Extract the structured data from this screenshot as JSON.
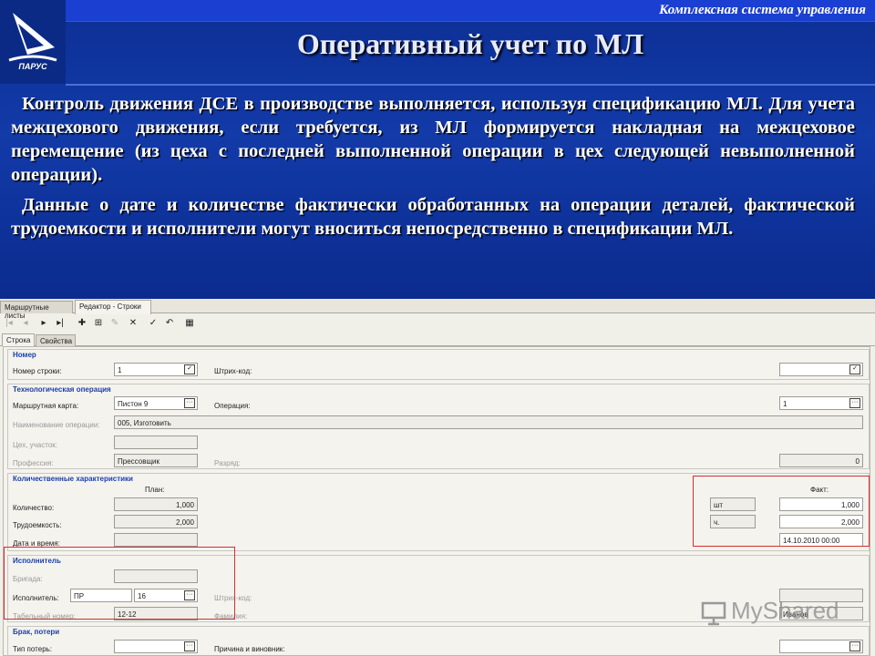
{
  "slide": {
    "header_text": "Комплексная система управления",
    "logo_text": "ПАРУС",
    "title": "Оперативный учет по МЛ",
    "paragraph1": "Контроль движения ДСЕ в производстве выполняется, используя спецификацию МЛ. Для учета межцехового движения, если требуется, из МЛ формируется накладная на межцеховое перемещение (из цеха с последней выполненной операции в цех следующей невыполненной операции).",
    "paragraph2": "Данные о дате и количестве фактически обработанных на операции деталей, фактической трудоемкости и исполнители могут вноситься непосредственно в спецификации МЛ."
  },
  "app": {
    "tabs": [
      "Маршрутные листы",
      "Редактор - Строки"
    ],
    "subtabs": [
      "Строка",
      "Свойства"
    ],
    "groups": {
      "number": {
        "title": "Номер",
        "row_number_label": "Номер строки:",
        "row_number_value": "1",
        "barcode_label": "Штрих-код:",
        "barcode_value": ""
      },
      "tech": {
        "title": "Технологическая операция",
        "route_card_label": "Маршрутная карта:",
        "route_card_value": "Пистон 9",
        "operation_label": "Операция:",
        "operation_value": "1",
        "op_name_label": "Наименование операции:",
        "op_name_value": "005, Изготовить",
        "shop_label": "Цех, участок:",
        "shop_value": "",
        "profession_label": "Профессия:",
        "profession_value": "Прессовщик",
        "grade_label": "Разряд:",
        "grade_value": "0"
      },
      "quant": {
        "title": "Количественные характеристики",
        "plan_header": "План:",
        "fact_header": "Факт:",
        "qty_label": "Количество:",
        "qty_plan": "1,000",
        "qty_unit": "шт",
        "qty_fact": "1,000",
        "labor_label": "Трудоемкость:",
        "labor_plan": "2,000",
        "labor_unit": "ч.",
        "labor_fact": "2,000",
        "date_label": "Дата и время:",
        "date_plan": "",
        "date_fact": "14.10.2010 00:00"
      },
      "executor": {
        "title": "Исполнитель",
        "brigade_label": "Бригада:",
        "brigade_value": "",
        "executor_label": "Исполнитель:",
        "executor_code": "ПР",
        "executor_num": "16",
        "barcode_label": "Штрих-код:",
        "barcode_value": "",
        "tab_num_label": "Табельный номер:",
        "tab_num_value": "12-12",
        "surname_label": "Фамилия:",
        "surname_value": "Иванов"
      },
      "defect": {
        "title": "Брак, потери",
        "loss_type_label": "Тип потерь:",
        "loss_type_value": "",
        "cause_label": "Причина и виновник:",
        "cause_value": ""
      }
    }
  },
  "watermark": "MyShared"
}
